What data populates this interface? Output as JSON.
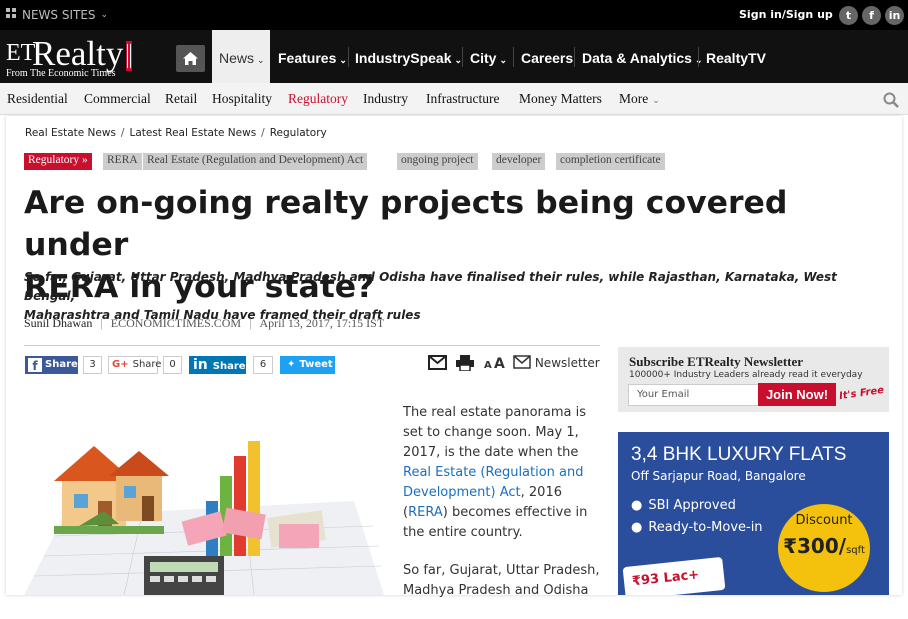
{
  "topbar": {
    "news_sites": "NEWS SITES",
    "sign_in": "Sign in/Sign up",
    "social": [
      "twitter-icon",
      "facebook-icon",
      "linkedin-icon"
    ]
  },
  "logo": {
    "et": "ET",
    "realty": "Realty",
    "sub": "From The Economic Times"
  },
  "nav": {
    "items": [
      {
        "label": "News",
        "has_caret": true
      },
      {
        "label": "Features",
        "has_caret": true
      },
      {
        "label": "IndustrySpeak",
        "has_caret": true
      },
      {
        "label": "City",
        "has_caret": true
      },
      {
        "label": "Careers",
        "has_caret": false
      },
      {
        "label": "Data & Analytics",
        "has_caret": true
      },
      {
        "label": "RealtyTV",
        "has_caret": false
      }
    ]
  },
  "subnav": {
    "items": [
      "Residential",
      "Commercial",
      "Retail",
      "Hospitality",
      "Regulatory",
      "Industry",
      "Infrastructure",
      "Money Matters",
      "More"
    ]
  },
  "breadcrumb": [
    "Real Estate News",
    "Latest Real Estate News",
    "Regulatory"
  ],
  "tags": {
    "primary": "Regulatory »",
    "others": [
      "RERA",
      "Real Estate (Regulation and Development) Act",
      "ongoing project",
      "developer",
      "completion certificate"
    ]
  },
  "article": {
    "headline_line1": "Are on-going realty projects being covered under",
    "headline_line2": "RERA in your state?",
    "synopsis_line1": "So far, Gujarat, Uttar Pradesh, Madhya Pradesh and Odisha have finalised their rules, while Rajasthan, Karnataka, West Bengal,",
    "synopsis_line2": "Maharashtra and Tamil Nadu have framed their draft rules",
    "author": "Sunil Dhawan",
    "source": "ECONOMICTIMES.COM",
    "date": "April 13, 2017, 17:15 IST",
    "p1_a": "The real estate panorama is set to change soon. May 1, 2017, is the date when the",
    "p1_link1": "Real Estate (Regulation and Development) Act",
    "p1_b": ", 2016 (",
    "p1_link2": "RERA",
    "p1_c": ") becomes effective in the entire country.",
    "p2": "So far, Gujarat, Uttar Pradesh, Madhya Pradesh and Odisha"
  },
  "share": {
    "fb_label": "Share",
    "fb_count": "3",
    "gplus_label": "Share",
    "gplus_count": "0",
    "in_label": "Share",
    "in_count": "6",
    "tw_label": "Tweet",
    "newsletter": "Newsletter",
    "font_small": "A",
    "font_large": "A"
  },
  "newsletter_box": {
    "title": "Subscribe ETRealty Newsletter",
    "subtitle": "100000+ Industry Leaders already read it everyday",
    "placeholder": "Your Email",
    "button": "Join Now!",
    "free": "It's Free"
  },
  "ad": {
    "title": "3,4 BHK LUXURY FLATS",
    "subtitle": "Off Sarjapur Road, Bangalore",
    "bullets": [
      "SBI Approved",
      "Ready-to-Move-in"
    ],
    "discount_label": "Discount",
    "discount_value": "₹300/",
    "discount_unit": "sqft",
    "lac": "₹93 Lac+"
  },
  "colors": {
    "brand_red": "#c8102e",
    "link_blue": "#1a6fc0",
    "nav_bg": "#111111",
    "fb": "#3b5998",
    "linkedin": "#0077b5",
    "twitter": "#1da1f2",
    "ad_blue": "#2a4e9c"
  }
}
